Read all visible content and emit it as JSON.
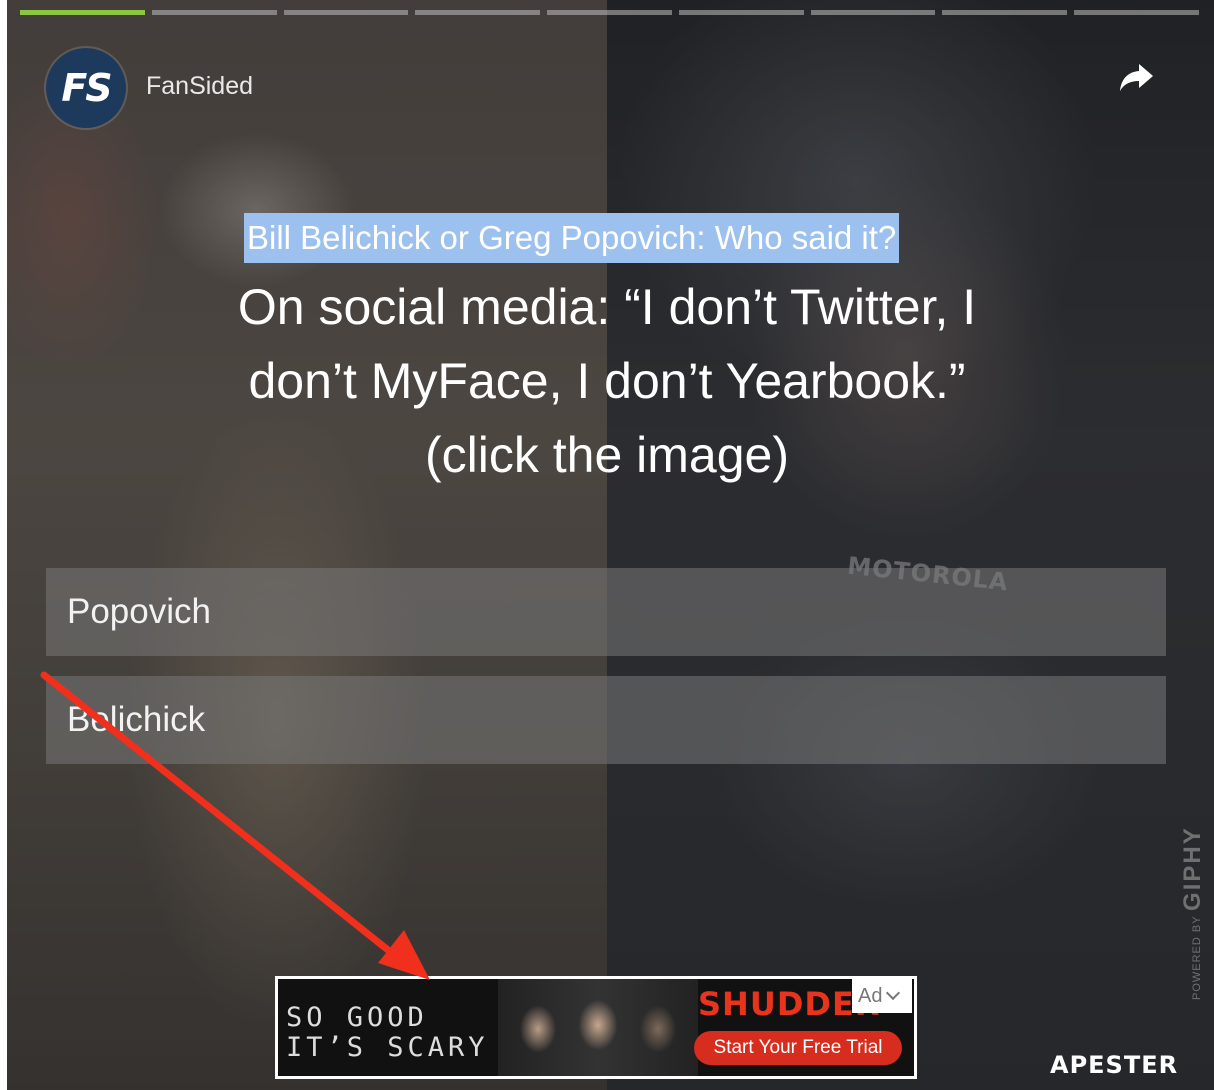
{
  "progress": {
    "total": 9,
    "current": 1
  },
  "header": {
    "brand_initials": "FS",
    "brand_name": "FanSided"
  },
  "quiz": {
    "title": "Bill Belichick or Greg Popovich: Who said it?",
    "question_line1": "On social media: “I don’t Twitter, I",
    "question_line2": "don’t MyFace, I don’t Yearbook.”",
    "question_line3": "(click the image)",
    "answers": [
      "Popovich",
      "Belichick"
    ]
  },
  "background": {
    "headset_text": "MOTOROLA"
  },
  "giphy": {
    "powered_by": "POWERED BY",
    "name": "GIPHY"
  },
  "ad": {
    "tagline_line1": "SO GOOD",
    "tagline_line2": "IT’S SCARY",
    "brand": "SHUDDER",
    "cta": "Start Your Free Trial",
    "badge": "Ad"
  },
  "footer": {
    "platform": "APESTER"
  },
  "colors": {
    "progress_active": "#8dc63f",
    "title_highlight": "#9cc1ee",
    "annotation_arrow": "#f0301c",
    "ad_accent": "#e8341c"
  }
}
